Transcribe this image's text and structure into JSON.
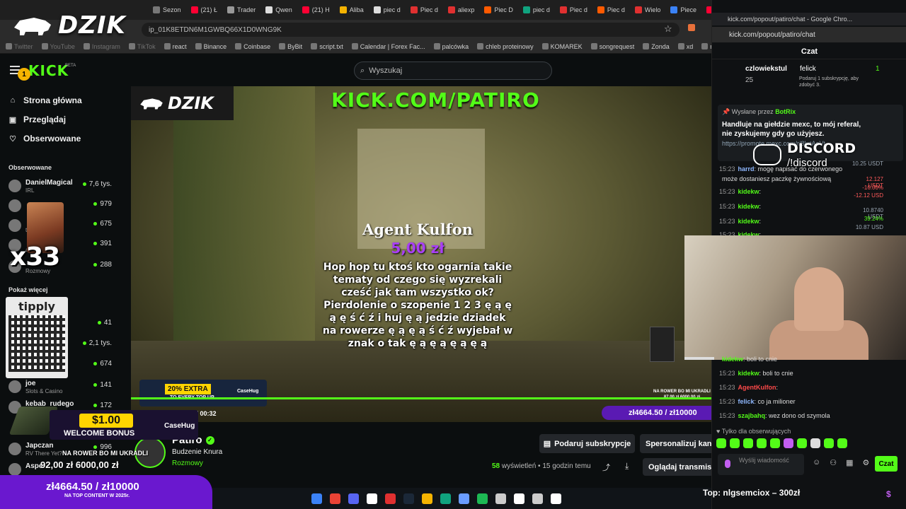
{
  "browser": {
    "tabs": [
      {
        "label": "Sezon",
        "color": "#777"
      },
      {
        "label": "(21) Ł",
        "color": "#ff0033"
      },
      {
        "label": "Trader",
        "color": "#999"
      },
      {
        "label": "Qwen",
        "color": "#ddd"
      },
      {
        "label": "(21) H",
        "color": "#ff0033"
      },
      {
        "label": "Aliba",
        "color": "#f5b301"
      },
      {
        "label": "piec d",
        "color": "#ddd"
      },
      {
        "label": "Piec d",
        "color": "#e03030"
      },
      {
        "label": "aliexp",
        "color": "#e03030"
      },
      {
        "label": "Piec D",
        "color": "#ff5a00"
      },
      {
        "label": "piec d",
        "color": "#10a37f"
      },
      {
        "label": "Piec d",
        "color": "#e03030"
      },
      {
        "label": "Piec d",
        "color": "#ff5a00"
      },
      {
        "label": "Wielo",
        "color": "#e03030"
      },
      {
        "label": "Piece",
        "color": "#3b82f6"
      },
      {
        "label": "(21) p",
        "color": "#ff0033"
      },
      {
        "label": "Pa",
        "color": "#53fc18"
      }
    ],
    "url_fragment": "ip_01K8ETDN6M1GWBQ66X1D0WNG9K",
    "bookmarks": [
      {
        "label": "Twitter",
        "dim": true
      },
      {
        "label": "YouTube",
        "dim": true
      },
      {
        "label": "Instagram",
        "dim": true
      },
      {
        "label": "TikTok",
        "dim": true
      },
      {
        "label": "react",
        "dim": false
      },
      {
        "label": "Binance",
        "dim": false
      },
      {
        "label": "Coinbase",
        "dim": false
      },
      {
        "label": "ByBit",
        "dim": false
      },
      {
        "label": "script.txt",
        "dim": false
      },
      {
        "label": "Calendar | Forex Fac...",
        "dim": false
      },
      {
        "label": "palcówka",
        "dim": false
      },
      {
        "label": "chleb proteinowy",
        "dim": false
      },
      {
        "label": "KOMAREK",
        "dim": false
      },
      {
        "label": "songrequest",
        "dim": false
      },
      {
        "label": "Zonda",
        "dim": false
      },
      {
        "label": "xd",
        "dim": false
      },
      {
        "label": "meble",
        "dim": false
      }
    ]
  },
  "overlay_logo": "DZIK",
  "header": {
    "logo": "KICK",
    "beta": "BETA",
    "search_placeholder": "Wyszukaj"
  },
  "sidebar": {
    "nav": [
      {
        "label": "Strona główna",
        "icon": "home-icon",
        "glyph": "⌂"
      },
      {
        "label": "Przeglądaj",
        "icon": "browse-icon",
        "glyph": "▣"
      },
      {
        "label": "Obserwowane",
        "icon": "heart-icon",
        "glyph": "♡"
      }
    ],
    "section_title": "Obserwowane",
    "followed": [
      {
        "name": "DanielMagical",
        "sub": "IRL",
        "viewers": "7,6 tys."
      },
      {
        "name": "",
        "sub": "",
        "viewers": "979"
      },
      {
        "name": "",
        "sub": "tics",
        "viewers": "675"
      },
      {
        "name": "",
        "sub": "a",
        "viewers": "391"
      },
      {
        "name": "",
        "sub": "Rozmowy",
        "viewers": "288"
      }
    ],
    "show_more": "Pokaż więcej",
    "followed_lower": [
      {
        "name": "",
        "sub": "",
        "viewers": "41"
      },
      {
        "name": "",
        "sub": "",
        "viewers": "2,1 tys."
      },
      {
        "name": "",
        "sub": "tics",
        "viewers": "674"
      },
      {
        "name": "joe",
        "sub": "Slots & Casino",
        "viewers": "141"
      },
      {
        "name": "kebab_rudego",
        "sub": "",
        "viewers": "172"
      },
      {
        "name": "Japczan",
        "sub": "RV There Yet?",
        "viewers": "996"
      },
      {
        "name": "Aspe",
        "sub": "",
        "viewers": ""
      }
    ]
  },
  "face_overlay": {
    "multiplier": "x33"
  },
  "qr_overlay": {
    "title": "tipply"
  },
  "video": {
    "logo_text": "DZIK",
    "channel_url": "KICK.COM/PATIRO",
    "donation": {
      "name": "Agent Kulfon",
      "amount": "5,00 zł",
      "message": "Hop hop tu ktoś kto ogarnia takie tematy od czego się wyzrekali cześć jak tam wszystko ok? Pierdolenie o szopenie 1 2 3 ę ą ę ą ę ś ć ź i huj ę ą jedzie dziadek na rowerze ę ą ę ą ś ć ź wyjebał w znak o tak ę ą ę ą ę ą ę ą"
    },
    "extra_pill": "20% EXTRA",
    "extra_sub": "TO EVERY TOP UP",
    "extra_brand": "CaseHug",
    "timecode": "9 / 00:32",
    "mini_goal": "zł4664.50 / zł10000",
    "mini_caption_1": "NA ROWER BO MI UKRADLI",
    "mini_caption_2": "87,00 zł   6000,00 zł"
  },
  "stream_info": {
    "streamer": "Patiro",
    "title": "Budzenie Knura",
    "category": "Rozmowy",
    "gift_button": "Podaruj subskrypcje",
    "personalize_button": "Spersonalizuj kanał",
    "viewers_count": "58",
    "viewers_label": "wyświetleń",
    "started": "15 godzin temu",
    "watch_button": "Oglądaj transmisję"
  },
  "promo": {
    "bonus_amount": "$1.00",
    "bonus_text": "WELCOME BONUS",
    "bonus_brand": "CaseHug",
    "goal2_label": "NA ROWER BO MI UKRADLI",
    "goal2_values": "92,00 zł    6000,00 zł",
    "bottom_goal": "zł4664.50 / zł10000",
    "bottom_goal_sub": "NA TOP CONTENT W 2025r."
  },
  "chat": {
    "window_title": "kick.com/popout/patiro/chat - Google Chro...",
    "address": "kick.com/popout/patiro/chat",
    "header": "Czat",
    "leaderboard": [
      {
        "rank": "1",
        "name": "czlowiekstul",
        "count": "25"
      },
      {
        "name": "felick",
        "count": "1",
        "note": "Podaruj 1 subskrypcję, aby zdobyć 3."
      }
    ],
    "pinned": {
      "by_label": "Wysłane przez",
      "by_user": "BotRix",
      "text": "Handluje na giełdzie mexc, to mój referal, nie zyskujemy gdy go użyjesz.",
      "link": "https://promote.mexc.com/r/8krtAoVt",
      "pinned_label": "Przypięte p"
    },
    "discord": {
      "title": "DISCORD",
      "command": "/!discord"
    },
    "messages_top": [
      {
        "time": "15:23",
        "user": "harrd",
        "color": "#8fb8ff",
        "text": ": mogę napisać do czerwonego"
      },
      {
        "time": "",
        "user": "",
        "color": "#ddd",
        "text": "może dostaniesz paczkę żywnościową"
      },
      {
        "time": "15:23",
        "user": "kidekw",
        "color": "#53fc18",
        "text": ":"
      },
      {
        "time": "15:23",
        "user": "kidekw",
        "color": "#53fc18",
        "text": ":"
      },
      {
        "time": "15:23",
        "user": "kidekw",
        "color": "#53fc18",
        "text": ":"
      },
      {
        "time": "15:23",
        "user": "kidekw",
        "color": "#53fc18",
        "text": ":"
      }
    ],
    "tickers": [
      {
        "value": "10.25 USDT",
        "tone": ""
      },
      {
        "value": "12.127 USDT",
        "tone": "red"
      },
      {
        "value": "-16.00%",
        "tone": "red"
      },
      {
        "value": "-12.12 USD",
        "tone": "red"
      },
      {
        "value": "10.8740 USDT",
        "tone": ""
      },
      {
        "value": "39.24%",
        "tone": "green"
      },
      {
        "value": "10.87 USD",
        "tone": ""
      }
    ],
    "messages_bottom": [
      {
        "time": "",
        "user": "kidekw",
        "color": "#53fc18",
        "text": ": boli to cnie"
      },
      {
        "time": "15:23",
        "user": "kidekw",
        "color": "#53fc18",
        "text": ": boli to cnie"
      },
      {
        "time": "15:23",
        "user": "AgentKulfon",
        "color": "#ff4a4a",
        "text": ":"
      },
      {
        "time": "15:23",
        "user": "felick",
        "color": "#8fb8ff",
        "text": ": co ja milioner"
      },
      {
        "time": "15:23",
        "user": "szajbahq",
        "color": "#53fc18",
        "text": ": wez dono od szymola"
      }
    ],
    "followers_only": "Tylko dla obserwujących",
    "input_placeholder": "Wyślij wiadomość",
    "send_button": "Czat"
  },
  "top_donor": "Top: nlgsemciox –  300zł",
  "taskbar_colors": [
    "#3b82f6",
    "#ea4335",
    "#5865f2",
    "#ffffff",
    "#e03030",
    "#1b2838",
    "#f5b301",
    "#10a37f",
    "#6a9cff",
    "#1db954",
    "#cccccc",
    "#ffffff",
    "#cccccc",
    "#ffffff"
  ],
  "accent": "#53fc18"
}
